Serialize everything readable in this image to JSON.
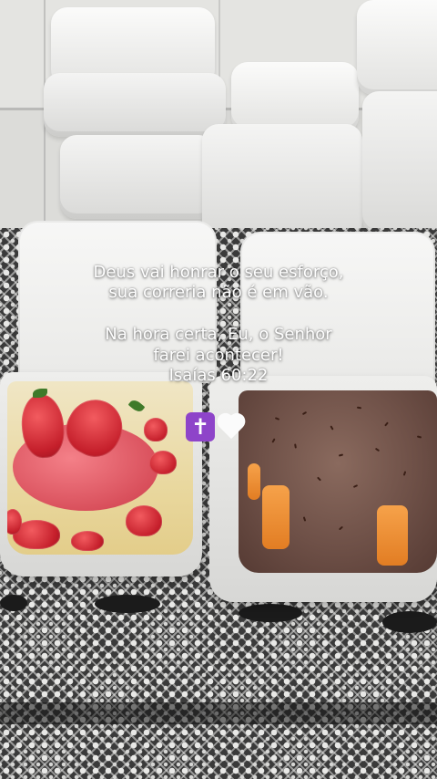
{
  "caption": {
    "line1": "Deus vai honrar o seu esforço,",
    "line2": "sua correria não é em vão.",
    "line3": "Na hora certa, Eu, o Senhor",
    "line4": "farei acontecer!",
    "line5": "Isaías 60:22"
  },
  "emojis": {
    "cross": "✝",
    "cross_icon": "latin-cross-icon",
    "heart_icon": "white-heart-icon"
  },
  "colors": {
    "caption_text": "#ffffff",
    "cross_bg": "#8e44c9",
    "heart": "#fbfbfb"
  }
}
